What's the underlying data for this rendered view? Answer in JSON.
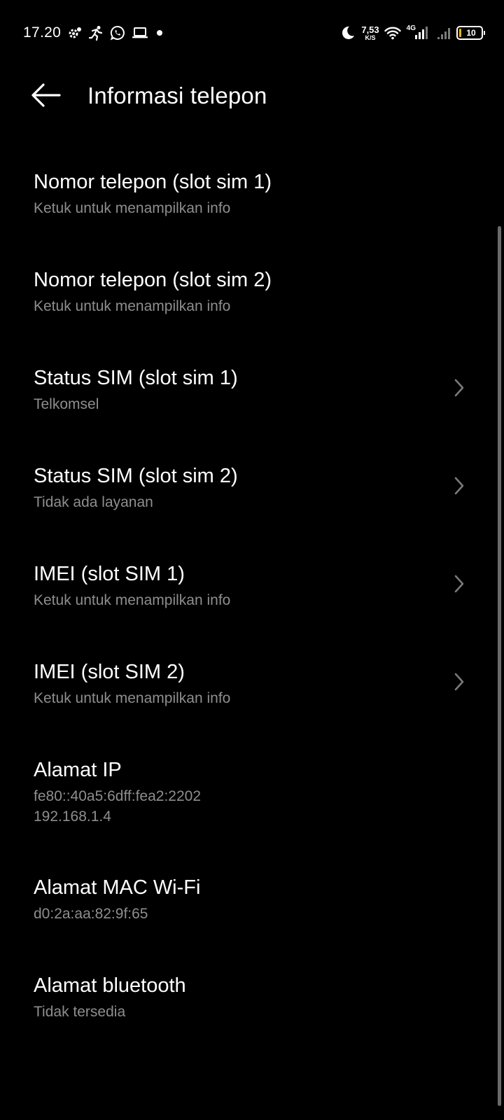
{
  "status_bar": {
    "time": "17.20",
    "left_icons": [
      "gear-notification-icon",
      "fitness-running-icon",
      "whatsapp-icon",
      "laptop-icon",
      "dot-icon"
    ],
    "net_speed_value": "7,53",
    "net_speed_unit": "K/S",
    "network_type": "4G",
    "battery_level": "10",
    "battery_color": "#f5b700"
  },
  "app_bar": {
    "back_icon": "arrow-left-icon",
    "title": "Informasi telepon"
  },
  "items": [
    {
      "title": "Nomor telepon (slot sim 1)",
      "subtitle": "Ketuk untuk menampilkan info",
      "chevron": false
    },
    {
      "title": "Nomor telepon (slot sim 2)",
      "subtitle": "Ketuk untuk menampilkan info",
      "chevron": false
    },
    {
      "title": "Status SIM (slot sim 1)",
      "subtitle": "Telkomsel",
      "chevron": true
    },
    {
      "title": "Status SIM (slot sim 2)",
      "subtitle": "Tidak ada layanan",
      "chevron": true
    },
    {
      "title": "IMEI (slot SIM 1)",
      "subtitle": "Ketuk untuk menampilkan info",
      "chevron": true
    },
    {
      "title": "IMEI (slot SIM 2)",
      "subtitle": "Ketuk untuk menampilkan info",
      "chevron": true
    },
    {
      "title": "Alamat IP",
      "subtitle": "fe80::40a5:6dff:fea2:2202",
      "subtitle2": "192.168.1.4",
      "chevron": false
    },
    {
      "title": "Alamat MAC Wi-Fi",
      "subtitle": "d0:2a:aa:82:9f:65",
      "chevron": false
    },
    {
      "title": "Alamat bluetooth",
      "subtitle": "Tidak tersedia",
      "chevron": false
    }
  ],
  "colors": {
    "background": "#000000",
    "primary_text": "#ffffff",
    "secondary_text": "#8e8e8e",
    "chevron": "#7a7a7a",
    "scrollbar": "#6a6a6a"
  }
}
